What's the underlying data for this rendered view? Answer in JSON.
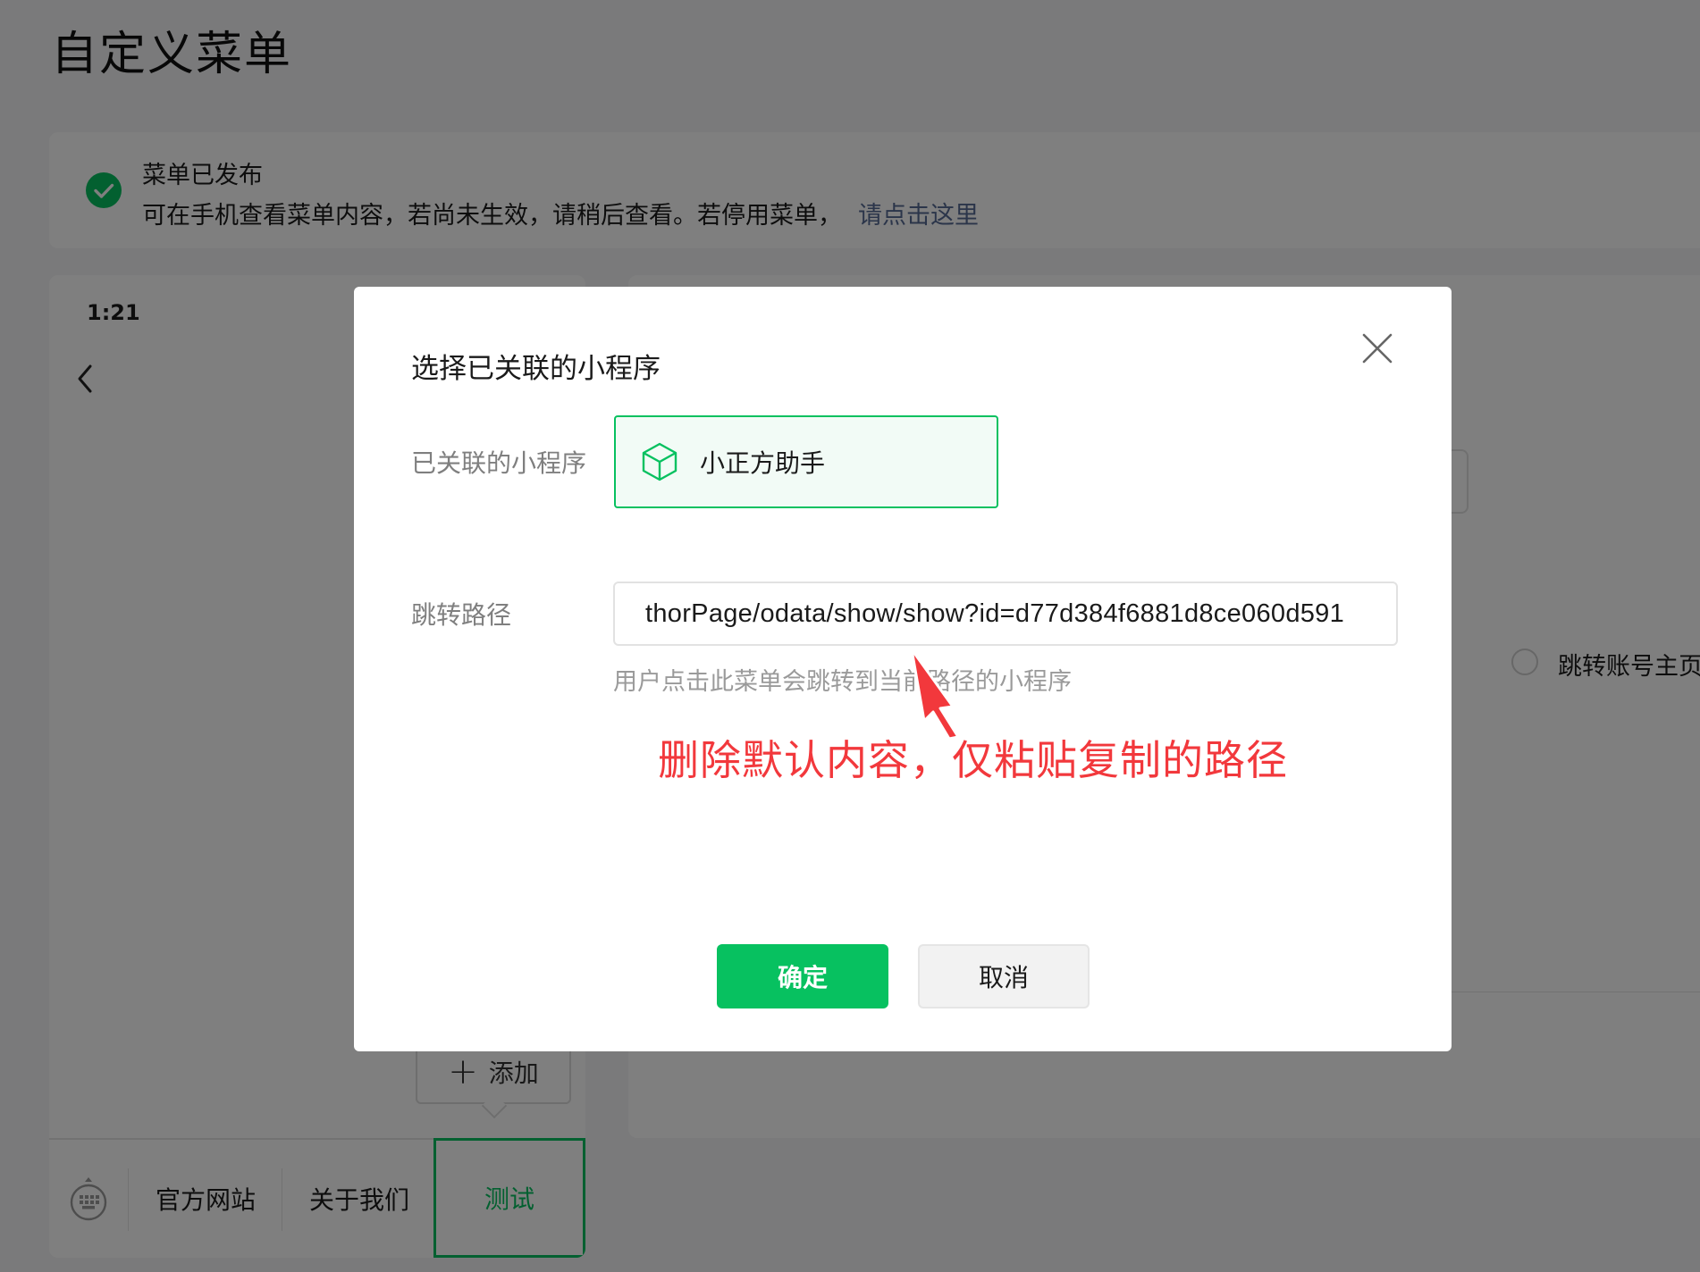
{
  "page": {
    "title": "自定义菜单"
  },
  "notice": {
    "status": "菜单已发布",
    "message": "可在手机查看菜单内容，若尚未生效，请稍后查看。若停用菜单，",
    "link": "请点击这里"
  },
  "phone": {
    "time": "1:21",
    "add_label": "添加",
    "menu_items": [
      "官方网站",
      "关于我们",
      "测试"
    ]
  },
  "settings": {
    "radio_label": "跳转账号主页"
  },
  "modal": {
    "title": "选择已关联的小程序",
    "mp_label": "已关联的小程序",
    "mp_name": "小正方助手",
    "path_label": "跳转路径",
    "path_value": "thorPage/odata/show/show?id=d77d384f6881d8ce060d591",
    "path_hint": "用户点击此菜单会跳转到当前路径的小程序",
    "annotation": "删除默认内容，仅粘贴复制的路径",
    "ok_label": "确定",
    "cancel_label": "取消"
  },
  "colors": {
    "accent": "#07c160",
    "link": "#576b95",
    "annotation": "#f2383c"
  }
}
